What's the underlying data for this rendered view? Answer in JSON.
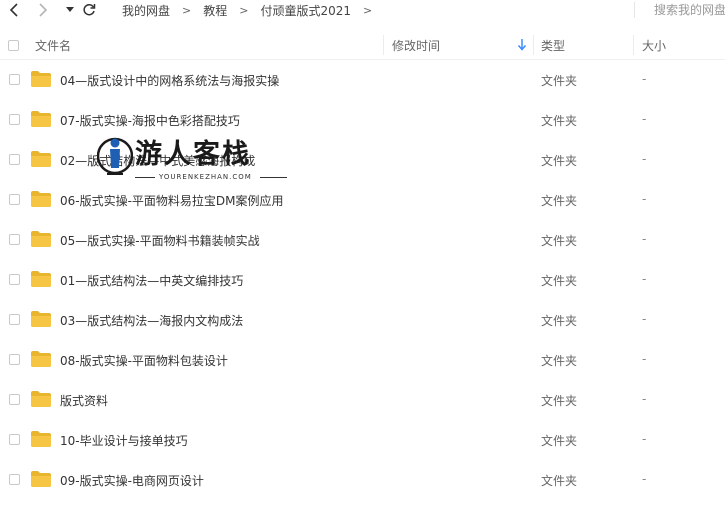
{
  "nav": {
    "back_icon": "chevron-left-icon",
    "forward_icon": "chevron-right-icon",
    "dropdown_icon": "triangle-down-icon",
    "refresh_icon": "refresh-icon"
  },
  "breadcrumb": {
    "items": [
      "我的网盘",
      "教程",
      "付顽童版式2021"
    ],
    "separator": ">"
  },
  "search": {
    "placeholder": "搜索我的网盘"
  },
  "columns": {
    "name": "文件名",
    "modified": "修改时间",
    "type": "类型",
    "size": "大小",
    "sort_icon": "arrow-down-icon"
  },
  "files": [
    {
      "name": "04—版式设计中的网格系统法与海报实操",
      "type": "文件夹",
      "size": "-"
    },
    {
      "name": "07-版式实操-海报中色彩搭配技巧",
      "type": "文件夹",
      "size": "-"
    },
    {
      "name": "02—版式结构法—中式美感海报构成",
      "type": "文件夹",
      "size": "-"
    },
    {
      "name": "06-版式实操-平面物料易拉宝DM案例应用",
      "type": "文件夹",
      "size": "-"
    },
    {
      "name": "05—版式实操-平面物料书籍装帧实战",
      "type": "文件夹",
      "size": "-"
    },
    {
      "name": "01—版式结构法—中英文编排技巧",
      "type": "文件夹",
      "size": "-"
    },
    {
      "name": "03—版式结构法—海报内文构成法",
      "type": "文件夹",
      "size": "-"
    },
    {
      "name": "08-版式实操-平面物料包装设计",
      "type": "文件夹",
      "size": "-"
    },
    {
      "name": "版式资料",
      "type": "文件夹",
      "size": "-"
    },
    {
      "name": "10-毕业设计与接单技巧",
      "type": "文件夹",
      "size": "-"
    },
    {
      "name": "09-版式实操-电商网页设计",
      "type": "文件夹",
      "size": "-"
    }
  ],
  "watermark": {
    "title": "游人客栈",
    "subtitle": "YOURENKEZHAN.COM"
  },
  "colors": {
    "folder": "#f5c543",
    "folder_dark": "#e9b52f",
    "sort_arrow": "#3b8cff",
    "logo_blue": "#1f5fb3"
  }
}
